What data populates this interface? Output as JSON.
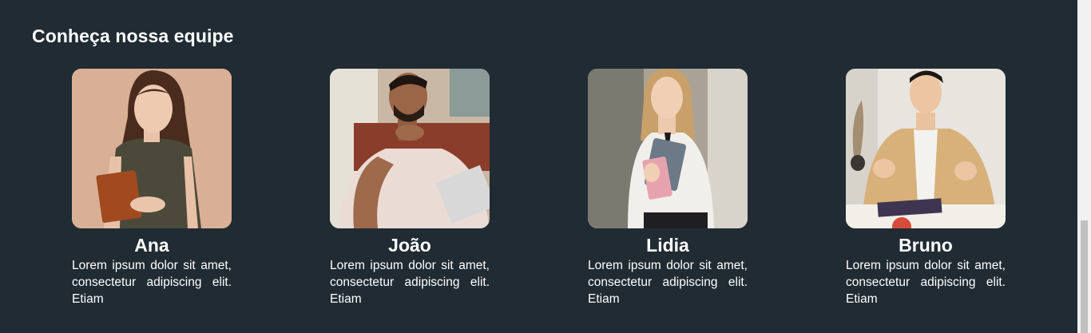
{
  "section": {
    "title": "Conheça nossa equipe"
  },
  "team": [
    {
      "name": "Ana",
      "description": "Lorem ipsum dolor sit amet, consectetur adipiscing elit. Etiam",
      "photo_alt": "Ana"
    },
    {
      "name": "João",
      "description": "Lorem ipsum dolor sit amet, consectetur adipiscing elit. Etiam",
      "photo_alt": "João"
    },
    {
      "name": "Lidia",
      "description": "Lorem ipsum dolor sit amet, consectetur adipiscing elit. Etiam",
      "photo_alt": "Lidia"
    },
    {
      "name": "Bruno",
      "description": "Lorem ipsum dolor sit amet, consectetur adipiscing elit. Etiam",
      "photo_alt": "Bruno"
    }
  ],
  "colors": {
    "background": "#202b33",
    "text": "#ffffff"
  }
}
